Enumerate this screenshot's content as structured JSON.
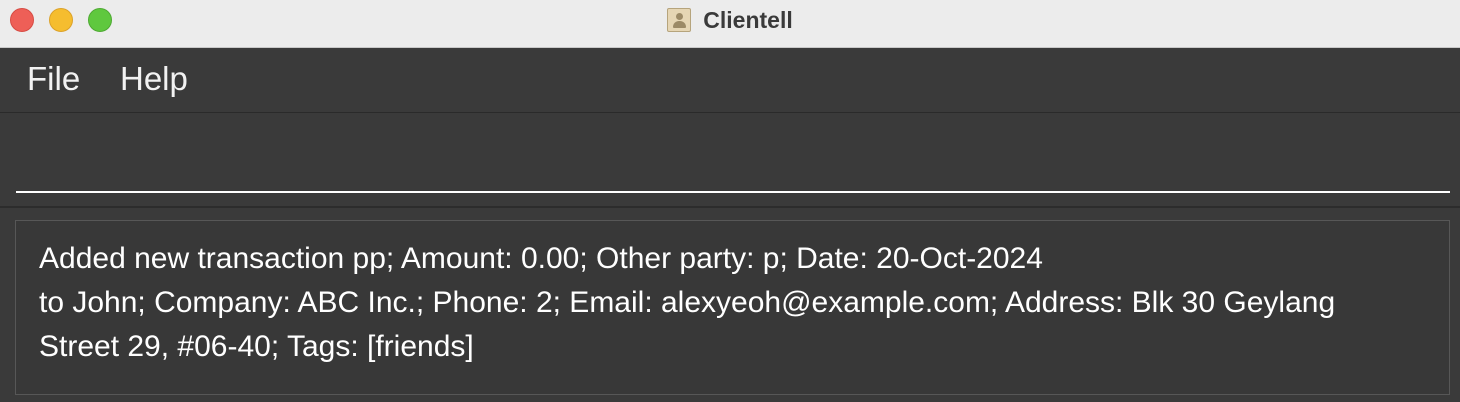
{
  "window": {
    "title": "Clientell"
  },
  "menu": {
    "file_label": "File",
    "help_label": "Help"
  },
  "command": {
    "value": ""
  },
  "result": {
    "lines": [
      "Added new transaction pp; Amount: 0.00; Other party: p; Date: 20-Oct-2024",
      "to John; Company: ABC Inc.; Phone: 2; Email: alexyeoh@example.com; Address: Blk 30 Geylang",
      "Street 29, #06-40; Tags: [friends]"
    ]
  },
  "colors": {
    "background": "#3a3a3a",
    "titlebar": "#ececec",
    "close": "#ee5f57",
    "minimize": "#f5bd2f",
    "maximize": "#5fc83e",
    "text": "#ffffff"
  },
  "icons": {
    "app": "contact-card-icon"
  }
}
